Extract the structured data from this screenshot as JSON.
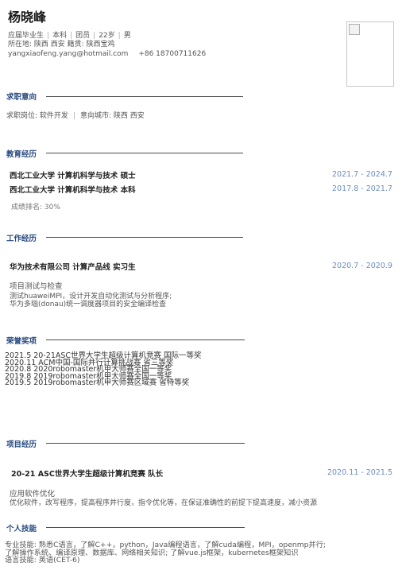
{
  "header": {
    "name": "杨晓峰",
    "line1": [
      "应届毕业生",
      "本科",
      "团员",
      "22岁",
      "男"
    ],
    "line2": "所在地:  陕西 西安 籍贯:  陕西宝鸡",
    "email": "yangxiaofeng.yang@hotmail.com",
    "phone": "+86 18700711626"
  },
  "intent": {
    "title": "求职意向",
    "position": "求职岗位:  软件开发",
    "city": "意向城市:  陕西 西安"
  },
  "education": {
    "title": "教育经历",
    "items": [
      {
        "school": "西北工业大学 计算机科学与技术 硕士",
        "dates": "2021.7 - 2024.7"
      },
      {
        "school": "西北工业大学 计算机科学与技术 本科",
        "dates": "2017.8 - 2021.7"
      }
    ],
    "rank": "成绩排名:  30%"
  },
  "work": {
    "title": "工作经历",
    "company": "华为技术有限公司 计算产品线 实习生",
    "dates": "2020.7 - 2020.9",
    "role": "项目测试与检查",
    "details": [
      "测试huaweiMPI，设计开发自动化测试与分析程序;",
      "华为多瑙(donau)统一调度器项目的安全编译检查"
    ]
  },
  "honors": {
    "title": "荣誉奖项",
    "items": [
      "2021.5 20-21ASC世界大学生超级计算机竞赛 国际一等奖",
      "2020.11 ACM中国-国际并行计算挑战赛 省三等奖",
      "2020.8 2020robomaster机甲大师赛全国一等奖",
      "2019.8 2019robomaster机甲大师赛全国一等奖",
      "2019.5 2019robomaster机甲大师赛区域赛 省特等奖"
    ]
  },
  "projects": {
    "title": "项目经历",
    "name": "20-21 ASC世界大学生超级计算机竞赛 队长",
    "dates": "2020.11 - 2021.5",
    "role": "应用软件优化",
    "detail": "优化软件，改写程序，提高程序并行度，指令优化等，在保证准确性的前提下提高速度，减小资源"
  },
  "skills": {
    "title": "个人技能",
    "lines": [
      "专业技能:  熟悉C语言，了解C++，python，Java编程语言，了解cuda编程，MPI，openmp并行;",
      "了解操作系统、编译原理、数据库、网络相关知识;  了解vue.js框架，kubernetes框架知识",
      "语言技能:  英语(CET-6)"
    ]
  }
}
